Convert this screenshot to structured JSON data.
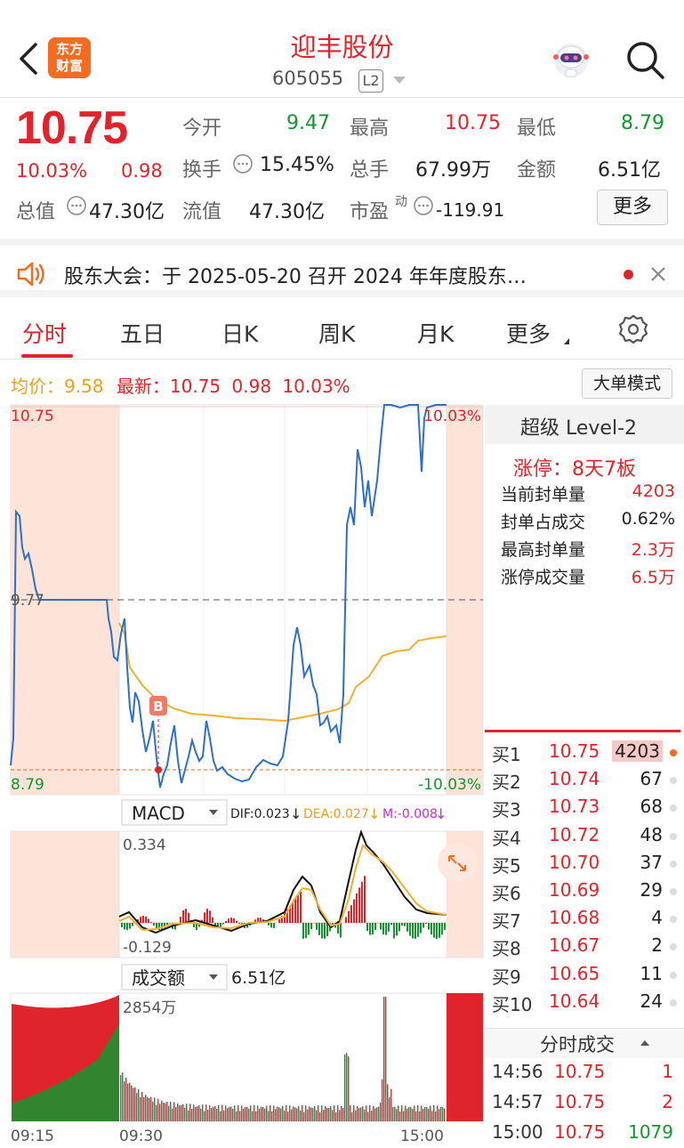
{
  "header": {
    "title": "迎丰股份",
    "code": "605055",
    "level_badge": "L2",
    "logo_line1": "东方",
    "logo_line2": "财富"
  },
  "quote": {
    "price": "10.75",
    "change_pct": "10.03%",
    "change": "0.98",
    "open_label": "今开",
    "open": "9.47",
    "high_label": "最高",
    "high": "10.75",
    "low_label": "最低",
    "low": "8.79",
    "turnover_label": "换手",
    "turnover": "15.45%",
    "volume_label": "总手",
    "volume": "67.99万",
    "amount_label": "金额",
    "amount": "6.51亿",
    "mktcap_label": "总值",
    "mktcap": "47.30亿",
    "float_label": "流值",
    "float_cap": "47.30亿",
    "pe_label": "市盈",
    "pe_sup": "动",
    "pe": "-119.91",
    "more_label": "更多"
  },
  "notice": {
    "text": "股东大会：于 2025-05-20 召开 2024 年年度股东…"
  },
  "tabs": [
    "分时",
    "五日",
    "日K",
    "周K",
    "月K",
    "更多"
  ],
  "active_tab": "分时",
  "chart_header": {
    "avg_label": "均价：",
    "avg": "9.58",
    "latest_label": "最新：",
    "latest": "10.75",
    "latest_change": "0.98",
    "latest_pct": "10.03%",
    "bigorder_label": "大单模式"
  },
  "chart_data": {
    "type": "line",
    "price_axis": {
      "top": "10.75",
      "mid": "9.77",
      "bottom": "8.79",
      "top_pct": "10.03%",
      "bottom_pct": "-10.03%"
    },
    "marker": "B",
    "macd": {
      "label": "MACD",
      "dif": "DIF:0.023",
      "dea": "DEA:0.027",
      "m": "M:-0.008",
      "top": "0.334",
      "bottom": "-0.129"
    },
    "volume": {
      "label": "成交额",
      "total": "6.51亿",
      "max": "2854万"
    },
    "time_axis": [
      "09:15",
      "09:30",
      "15:00"
    ],
    "price_series": [
      9.8,
      9.76,
      9.72,
      9.67,
      9.65,
      9.6,
      9.7,
      9.5,
      9.3,
      9.2,
      9.1,
      9.0,
      8.95,
      9.05,
      9.1,
      8.95,
      8.9,
      8.88,
      8.85,
      8.9,
      8.95,
      9.0,
      9.3,
      9.6,
      9.5,
      9.3,
      9.35,
      9.1,
      9.15,
      9.4,
      10.0,
      10.3,
      10.2,
      10.5,
      10.6,
      10.75,
      10.75,
      10.75,
      10.6,
      10.75,
      10.75
    ],
    "avg_series": [
      9.5,
      9.4,
      9.3,
      9.3,
      9.3,
      9.3,
      9.35,
      9.3,
      9.3,
      9.35,
      9.4,
      9.42,
      9.45,
      9.5,
      9.55,
      9.58
    ]
  },
  "level2": {
    "title": "超级 Level-2",
    "limit_up": "涨停：8天7板",
    "rows": [
      {
        "label": "当前封单量",
        "value": "4203"
      },
      {
        "label": "封单占成交",
        "value": "0.62%"
      },
      {
        "label": "最高封单量",
        "value": "2.3万"
      },
      {
        "label": "涨停成交量",
        "value": "6.5万"
      }
    ]
  },
  "bids": [
    {
      "label": "买1",
      "price": "10.75",
      "vol": "4203"
    },
    {
      "label": "买2",
      "price": "10.74",
      "vol": "67"
    },
    {
      "label": "买3",
      "price": "10.73",
      "vol": "68"
    },
    {
      "label": "买4",
      "price": "10.72",
      "vol": "48"
    },
    {
      "label": "买5",
      "price": "10.70",
      "vol": "37"
    },
    {
      "label": "买6",
      "price": "10.69",
      "vol": "29"
    },
    {
      "label": "买7",
      "price": "10.68",
      "vol": "4"
    },
    {
      "label": "买8",
      "price": "10.67",
      "vol": "2"
    },
    {
      "label": "买9",
      "price": "10.65",
      "vol": "11"
    },
    {
      "label": "买10",
      "price": "10.64",
      "vol": "24"
    }
  ],
  "ticks": {
    "title": "分时成交",
    "rows": [
      {
        "time": "14:56",
        "price": "10.75",
        "vol": "1"
      },
      {
        "time": "14:57",
        "price": "10.75",
        "vol": "2"
      },
      {
        "time": "15:00",
        "price": "10.75",
        "vol": "1079"
      }
    ]
  },
  "colors": {
    "up": "#e0242b",
    "down": "#14952f",
    "price_line": "#2f6fc6",
    "avg_line": "#f0b030",
    "accent": "#f36c21"
  }
}
